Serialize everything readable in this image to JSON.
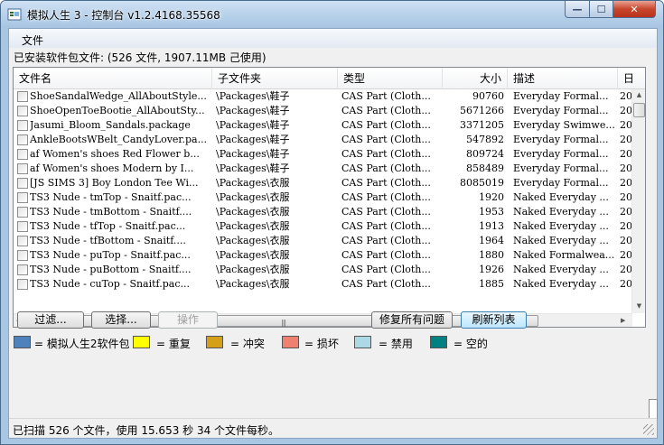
{
  "window": {
    "title": "模拟人生 3 - 控制台 v1.2.4168.35568",
    "min_glyph": "—",
    "max_glyph": "☐",
    "close_glyph": "✕"
  },
  "menu": {
    "file_label": "文件"
  },
  "installed_label": "已安装软件包文件: (526 文件, 1907.11MB 己使用)",
  "columns": {
    "name": "文件名",
    "subfolder": "子文件夹",
    "type": "类型",
    "size": "大小",
    "description": "描述",
    "date": "日"
  },
  "rows": [
    {
      "name": "ShoeSandalWedge_AllAboutStyle...",
      "subfolder": "\\Packages\\鞋子",
      "type": "CAS Part (Cloth...",
      "size": "90760",
      "description": "Everyday Formal...",
      "date": "20"
    },
    {
      "name": "ShoeOpenToeBootie_AllAboutSty...",
      "subfolder": "\\Packages\\鞋子",
      "type": "CAS Part (Cloth...",
      "size": "5671266",
      "description": "Everyday Formal...",
      "date": "20"
    },
    {
      "name": "Jasumi_Bloom_Sandals.package",
      "subfolder": "\\Packages\\鞋子",
      "type": "CAS Part (Cloth...",
      "size": "3371205",
      "description": "Everyday Swimwe...",
      "date": "20"
    },
    {
      "name": "AnkleBootsWBelt_CandyLover.pa...",
      "subfolder": "\\Packages\\鞋子",
      "type": "CAS Part (Cloth...",
      "size": "547892",
      "description": "Everyday Formal...",
      "date": "20"
    },
    {
      "name": "af Women's shoes Red Flower b...",
      "subfolder": "\\Packages\\鞋子",
      "type": "CAS Part (Cloth...",
      "size": "809724",
      "description": "Everyday Formal...",
      "date": "20"
    },
    {
      "name": "af  Women's shoes Modern by I...",
      "subfolder": "\\Packages\\鞋子",
      "type": "CAS Part (Cloth...",
      "size": "858489",
      "description": "Everyday Formal...",
      "date": "20"
    },
    {
      "name": "[JS SIMS 3] Boy London Tee Wi...",
      "subfolder": "\\Packages\\衣服",
      "type": "CAS Part (Cloth...",
      "size": "8085019",
      "description": "Everyday Formal...",
      "date": "20"
    },
    {
      "name": "TS3 Nude - tmTop - Snaitf.pac...",
      "subfolder": "\\Packages\\衣服",
      "type": "CAS Part (Cloth...",
      "size": "1920",
      "description": "Naked Everyday ...",
      "date": "20"
    },
    {
      "name": "TS3 Nude - tmBottom - Snaitf....",
      "subfolder": "\\Packages\\衣服",
      "type": "CAS Part (Cloth...",
      "size": "1953",
      "description": "Naked Everyday ...",
      "date": "20"
    },
    {
      "name": "TS3 Nude - tfTop - Snaitf.pac...",
      "subfolder": "\\Packages\\衣服",
      "type": "CAS Part (Cloth...",
      "size": "1913",
      "description": "Naked Everyday ...",
      "date": "20"
    },
    {
      "name": "TS3 Nude - tfBottom - Snaitf....",
      "subfolder": "\\Packages\\衣服",
      "type": "CAS Part (Cloth...",
      "size": "1964",
      "description": "Naked Everyday ...",
      "date": "20"
    },
    {
      "name": "TS3 Nude - puTop - Snaitf.pac...",
      "subfolder": "\\Packages\\衣服",
      "type": "CAS Part (Cloth...",
      "size": "1880",
      "description": "Naked Formalwea...",
      "date": "20"
    },
    {
      "name": "TS3 Nude - puBottom - Snaitf....",
      "subfolder": "\\Packages\\衣服",
      "type": "CAS Part (Cloth...",
      "size": "1926",
      "description": "Naked Everyday ...",
      "date": "20"
    },
    {
      "name": "TS3 Nude - cuTop - Snaitf.pac...",
      "subfolder": "\\Packages\\衣服",
      "type": "CAS Part (Cloth...",
      "size": "1885",
      "description": "Naked Everyday ...",
      "date": "20"
    }
  ],
  "buttons": {
    "filter": "过滤...",
    "select": "选择...",
    "action": "操作",
    "fix_all": "修复所有问题",
    "refresh": "刷新列表"
  },
  "legend": [
    {
      "color": "#4f81bd",
      "label": "= 模拟人生2软件包"
    },
    {
      "color": "#ffff00",
      "label": "= 重复"
    },
    {
      "color": "#d4a017",
      "label": "= 冲突"
    },
    {
      "color": "#f08070",
      "label": "= 损坏"
    },
    {
      "color": "#add8e6",
      "label": "= 禁用"
    },
    {
      "color": "#008080",
      "label": "= 空的"
    }
  ],
  "status": "已扫描 526 个文件，使用 15.653 秒 34 个文件每秒。"
}
